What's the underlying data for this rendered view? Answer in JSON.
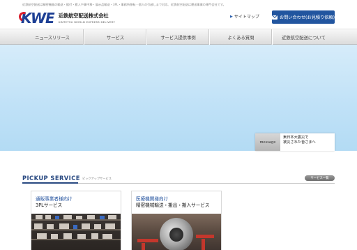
{
  "header": {
    "tagline": "近鉄航空配送は精密機器の輸送・据付・搬入や事中移・展示品輸送・3PL・事務所移転・個人の引越しまで対応、近鉄航空配送は運送事業の専門会社です。",
    "logo_mark": "KWE",
    "company_name": "近鉄航空配送株式会社",
    "company_name_en": "KINTETSU WORLD EXPRESS DELIVERY",
    "sitemap_label": "サイトマップ",
    "contact_label": "お問い合わせ(お見積り依頼)"
  },
  "nav": {
    "items": [
      {
        "label": "ニュースリリース"
      },
      {
        "label": "サービス"
      },
      {
        "label": "サービス提供事例"
      },
      {
        "label": "よくある質問"
      },
      {
        "label": "近鉄航空配送について"
      }
    ]
  },
  "hero": {
    "message_tag": "message",
    "message_text_1": "東日本大震災で",
    "message_text_2": "被災された皆さまへ"
  },
  "pickup": {
    "title": "PICKUP SERVICE",
    "subtitle": "ピックアップサービス",
    "more_label": "サービス一覧",
    "cards": [
      {
        "line1": "通販事業者様向け",
        "line2": "3PLサービス"
      },
      {
        "line1": "医療機関様向け",
        "line2": "精密機械輸送・搬出・搬入サービス"
      }
    ]
  },
  "colors": {
    "brand_blue": "#21559f",
    "logo_red": "#d81e2c",
    "hero_sky": "#c4e4f8",
    "nav_bg": "#e6e6e6"
  }
}
